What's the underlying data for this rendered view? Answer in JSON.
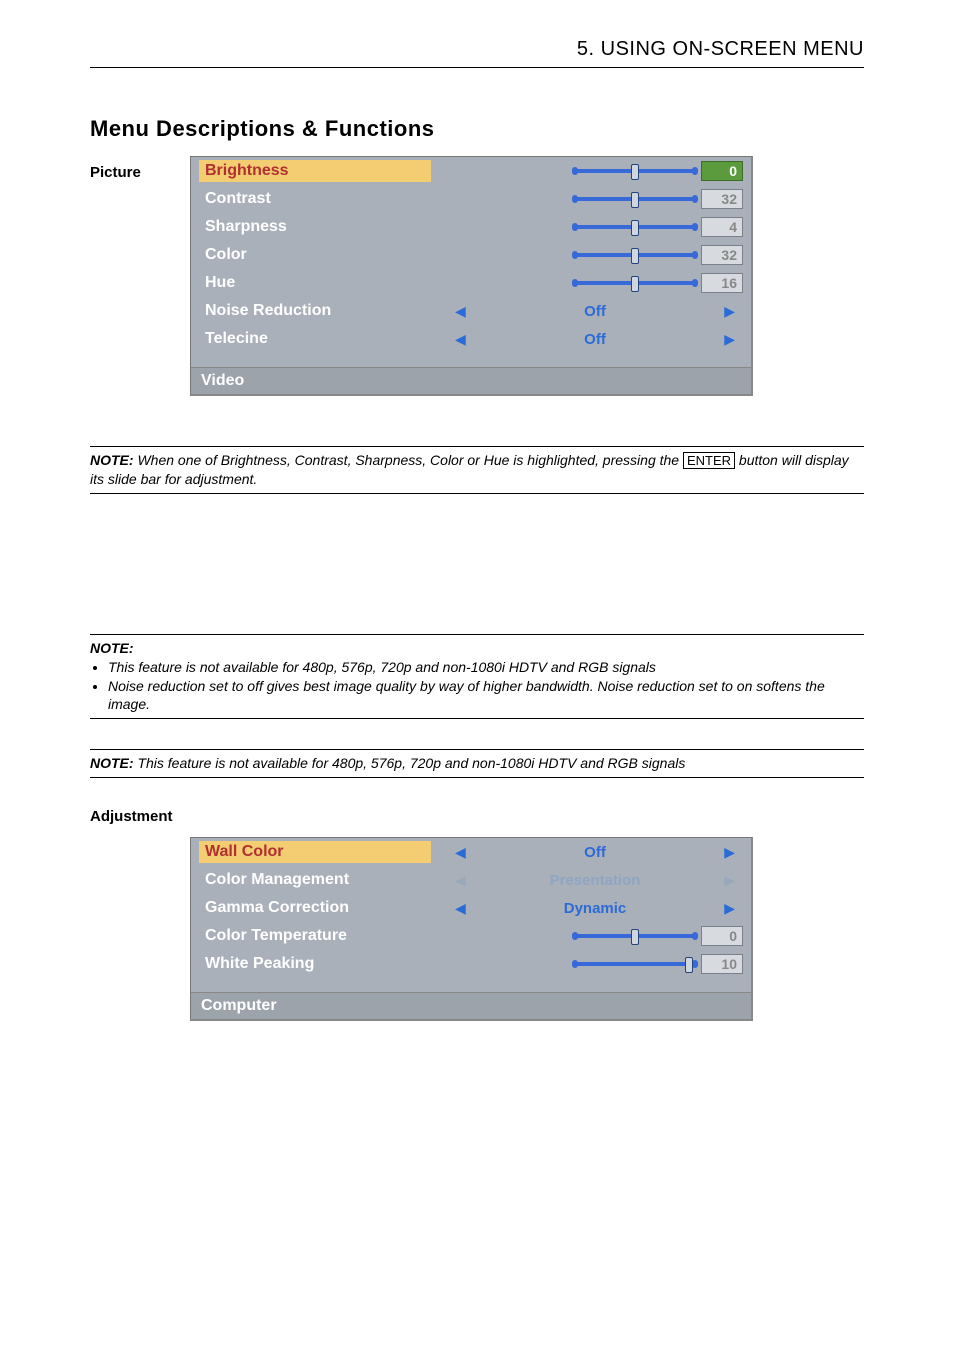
{
  "header": {
    "chapter": "5. USING ON-SCREEN MENU"
  },
  "titles": {
    "main": "Menu Descriptions & Functions",
    "picture": "Picture",
    "adjustment": "Adjustment"
  },
  "osd_picture": {
    "rows": [
      {
        "label": "Brightness",
        "type": "slider",
        "value": "0",
        "selected": true,
        "enabled": true,
        "pos": 50
      },
      {
        "label": "Contrast",
        "type": "slider",
        "value": "32",
        "selected": false,
        "enabled": false,
        "pos": 50
      },
      {
        "label": "Sharpness",
        "type": "slider",
        "value": "4",
        "selected": false,
        "enabled": false,
        "pos": 50
      },
      {
        "label": "Color",
        "type": "slider",
        "value": "32",
        "selected": false,
        "enabled": false,
        "pos": 50
      },
      {
        "label": "Hue",
        "type": "slider",
        "value": "16",
        "selected": false,
        "enabled": false,
        "pos": 50
      },
      {
        "label": "Noise Reduction",
        "type": "option",
        "value": "Off",
        "active": true
      },
      {
        "label": "Telecine",
        "type": "option",
        "value": "Off",
        "active": true
      }
    ],
    "footer": "Video"
  },
  "osd_adjustment": {
    "rows": [
      {
        "label": "Wall Color",
        "type": "option",
        "value": "Off",
        "selected": true,
        "active": true
      },
      {
        "label": "Color Management",
        "type": "option",
        "value": "Presentation",
        "selected": false,
        "active": false
      },
      {
        "label": "Gamma Correction",
        "type": "option",
        "value": "Dynamic",
        "selected": false,
        "active": true
      },
      {
        "label": "Color Temperature",
        "type": "slider",
        "value": "0",
        "enabled": false,
        "pos": 50
      },
      {
        "label": "White Peaking",
        "type": "slider",
        "value": "10",
        "enabled": false,
        "pos": 95
      }
    ],
    "footer": "Computer"
  },
  "notes": {
    "lead": "NOTE:",
    "n1_a": "When one of Brightness, Contrast, Sharpness, Color or Hue is highlighted, pressing the ",
    "n1_enter": "ENTER",
    "n1_b": " button will display its slide bar for adjustment.",
    "n2_items": [
      "This feature is not available for 480p, 576p, 720p and non-1080i HDTV and RGB signals",
      "Noise reduction set to off gives best image quality by way of higher bandwidth. Noise reduction set to on softens the image."
    ],
    "n3": "This feature is not available for 480p, 576p, 720p and non-1080i HDTV and RGB signals"
  }
}
